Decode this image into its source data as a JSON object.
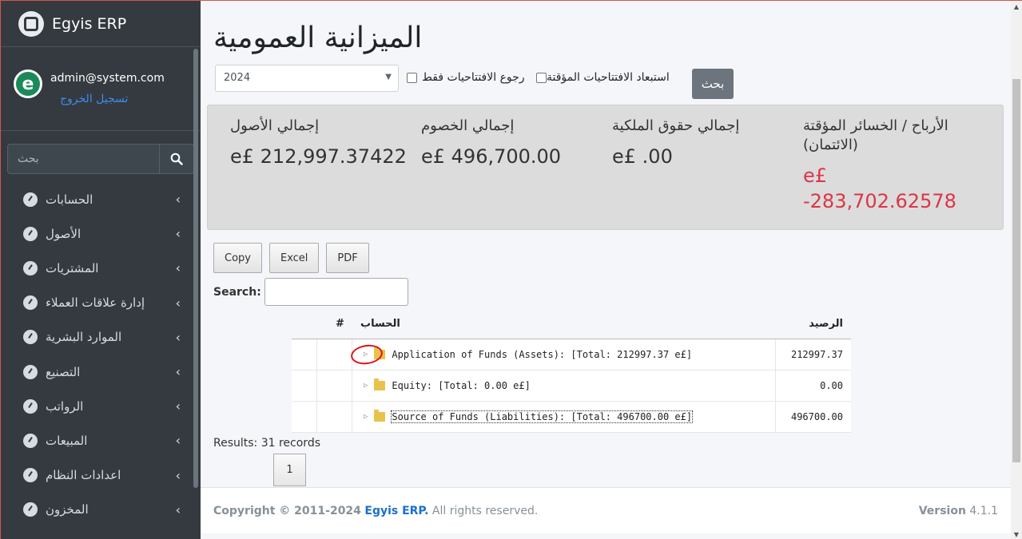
{
  "brand": {
    "name": "Egyis ERP"
  },
  "user": {
    "email": "admin@system.com",
    "logout_label": "تسجيل الخروج",
    "avatar_letter": "e"
  },
  "sidebar": {
    "search_placeholder": "بحث",
    "items": [
      {
        "label": "الحسابات"
      },
      {
        "label": "الأصول"
      },
      {
        "label": "المشتريات"
      },
      {
        "label": "إدارة علاقات العملاء"
      },
      {
        "label": "الموارد البشرية"
      },
      {
        "label": "التصنيع"
      },
      {
        "label": "الرواتب"
      },
      {
        "label": "المبيعات"
      },
      {
        "label": "اعدادات النظام"
      },
      {
        "label": "المخزون"
      }
    ]
  },
  "page": {
    "title": "الميزانية العمومية"
  },
  "filters": {
    "year": "2024",
    "exclude_temp_openings": "استبعاد الافتتاحيات المؤقتة",
    "return_openings_only": "رجوع الافتتاحيات فقط",
    "search_button": "بحث"
  },
  "summary": {
    "assets": {
      "label": "إجمالي الأصول",
      "value": "e£ 212,997.37422"
    },
    "liabilities": {
      "label": "إجمالي الخصوم",
      "value": "e£ 496,700.00"
    },
    "equity": {
      "label": "إجمالي حقوق الملكية",
      "value": "e£ .00"
    },
    "profit_loss": {
      "label": "الأرباح / الخسائر المؤقتة (الائتمان)",
      "value_currency": "e£",
      "value": "-283,702.62578",
      "color": "#dc3545"
    }
  },
  "table_tools": {
    "copy": "Copy",
    "excel": "Excel",
    "pdf": "PDF",
    "search_label": "Search:"
  },
  "tree": {
    "headers": {
      "hash": "#",
      "account": "الحساب",
      "balance": "الرصيد"
    },
    "rows": [
      {
        "label": "Application of Funds (Assets): [Total: 212997.37 e£]",
        "balance": "212997.37"
      },
      {
        "label": "Equity: [Total: 0.00 e£]",
        "balance": "0.00"
      },
      {
        "label": "Source of Funds (Liabilities): [Total: 496700.00 e£]",
        "balance": "496700.00"
      }
    ]
  },
  "pagination": {
    "results": "Results: 31 records",
    "page": "1"
  },
  "footer": {
    "copyright_prefix": "Copyright © 2011-2024",
    "brand": "Egyis ERP.",
    "rights": "All rights reserved.",
    "version_label": "Version",
    "version": "4.1.1"
  }
}
